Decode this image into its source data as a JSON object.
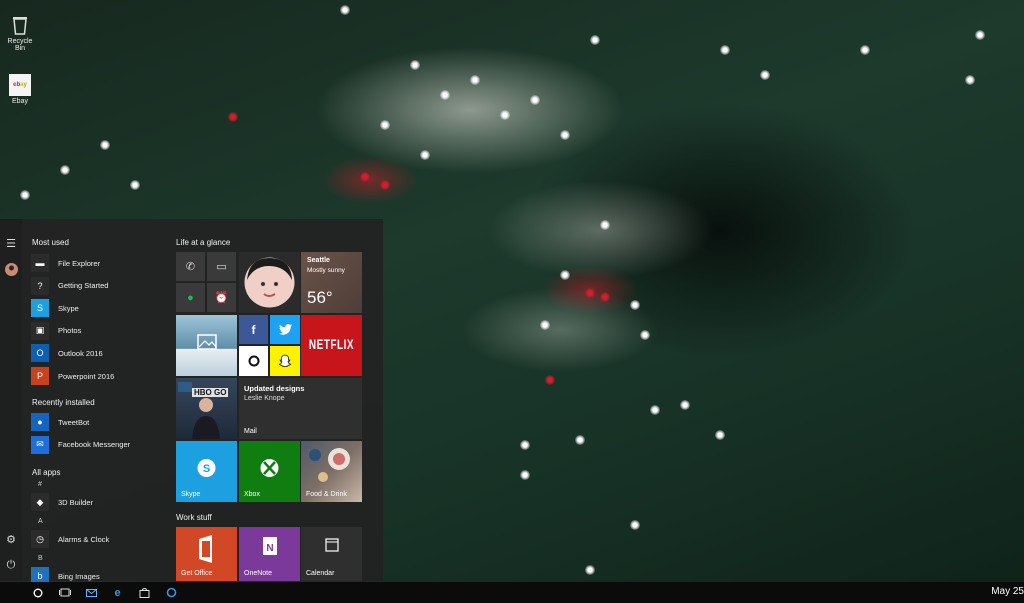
{
  "desktop": {
    "icons": [
      {
        "label": "Recycle Bin",
        "icon": "recycle-bin-icon"
      },
      {
        "label": "Ebay",
        "icon": "ebay-icon"
      }
    ]
  },
  "start_menu": {
    "most_used_title": "Most used",
    "most_used": [
      {
        "label": "File Explorer",
        "icon": "folder-icon",
        "color": "#2b2b2b"
      },
      {
        "label": "Getting Started",
        "icon": "help-icon",
        "color": "#2b2b2b"
      },
      {
        "label": "Skype",
        "icon": "skype-icon",
        "color": "#1da0e0"
      },
      {
        "label": "Photos",
        "icon": "photos-icon",
        "color": "#2b2b2b"
      },
      {
        "label": "Outlook 2016",
        "icon": "outlook-icon",
        "color": "#0e5eb3"
      },
      {
        "label": "Powerpoint 2016",
        "icon": "powerpoint-icon",
        "color": "#c8421f"
      }
    ],
    "recently_installed_title": "Recently installed",
    "recently_installed": [
      {
        "label": "TweetBot",
        "icon": "tweetbot-icon",
        "color": "#1565c0"
      },
      {
        "label": "Facebook Messenger",
        "icon": "messenger-icon",
        "color": "#1e6fd9"
      }
    ],
    "all_apps_title": "All apps",
    "all_apps": [
      {
        "type": "letter",
        "label": "#"
      },
      {
        "type": "app",
        "label": "3D Builder",
        "icon": "3d-builder-icon",
        "color": "#2b2b2b"
      },
      {
        "type": "letter",
        "label": "A"
      },
      {
        "type": "app",
        "label": "Alarms & Clock",
        "icon": "alarm-clock-icon",
        "color": "#2b2b2b"
      },
      {
        "type": "letter",
        "label": "B"
      },
      {
        "type": "app",
        "label": "Bing Images",
        "icon": "bing-icon",
        "color": "#1e73b8"
      }
    ]
  },
  "tiles": {
    "group1_title": "Life at a glance",
    "weather": {
      "city": "Seattle",
      "condition": "Mostly sunny",
      "temp": "56°"
    },
    "mail": {
      "subject": "Updated designs",
      "sender": "Leslie Knope",
      "label": "Mail"
    },
    "netflix": "NETFLIX",
    "hbo": "HBO GO",
    "skype": "Skype",
    "xbox": "Xbox",
    "food": "Food & Drink",
    "group2_title": "Work stuff",
    "office": "Get Office",
    "onenote": "OneNote",
    "calendar": "Calendar"
  },
  "taskbar": {
    "clock": "May 25"
  },
  "colors": {
    "accent": "#1da0e0",
    "netflix": "#c8151c",
    "xbox": "#0f7d10",
    "snapchat": "#fff200",
    "office": "#d24726",
    "onenote": "#7b3a9a",
    "facebook": "#3b5998",
    "twitter": "#1da1f2"
  }
}
